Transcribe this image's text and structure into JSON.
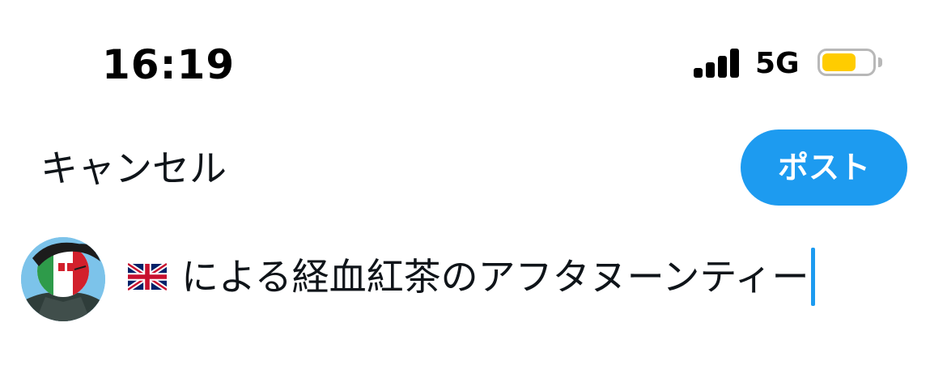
{
  "status_bar": {
    "time": "16:19",
    "network": "5G",
    "signal_bars": 4,
    "battery_level": 0.68,
    "battery_color": "#ffcc00",
    "icons": [
      "signal-icon",
      "battery-icon"
    ]
  },
  "compose": {
    "cancel_label": "キャンセル",
    "post_label": "ポスト",
    "text": "による経血紅茶のアフタヌーンティー",
    "leading_emoji": "uk-flag-icon",
    "avatar": "user-avatar"
  },
  "colors": {
    "accent": "#1d9bf0",
    "text": "#0f1419"
  }
}
